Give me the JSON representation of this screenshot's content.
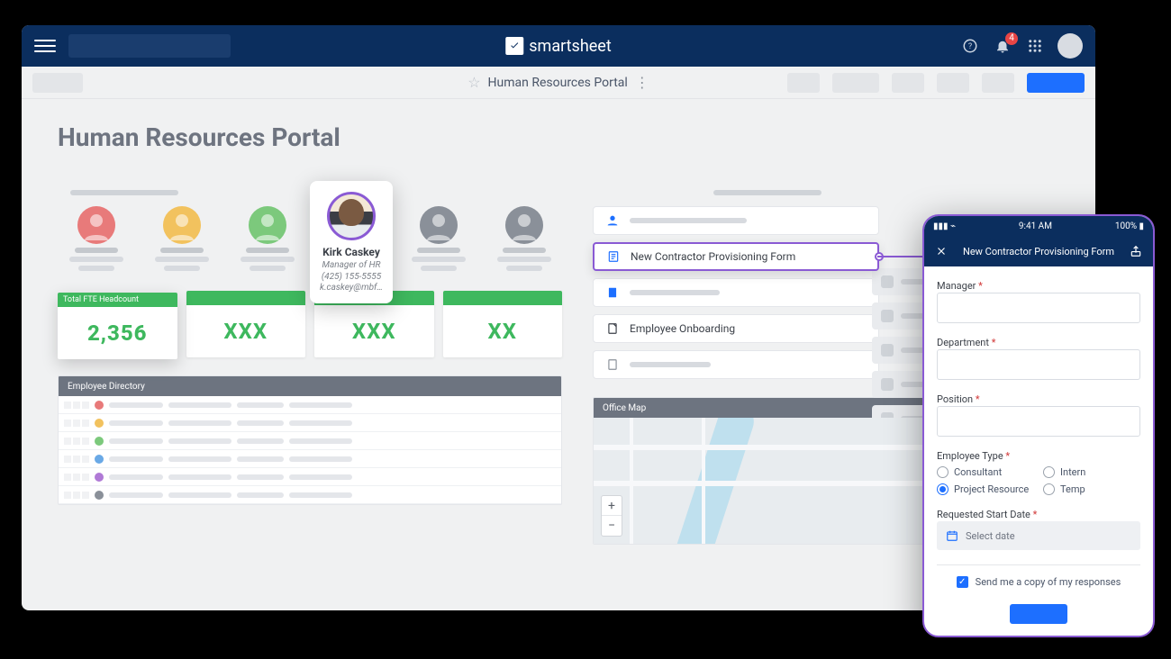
{
  "brand": "smartsheet",
  "topbar": {
    "notif_count": "4"
  },
  "breadcrumb": {
    "title": "Human Resources Portal"
  },
  "page": {
    "title": "Human Resources Portal"
  },
  "person_card": {
    "name": "Kirk Caskey",
    "role": "Manager of HR",
    "phone": "(425) 155-5555",
    "email": "k.caskey@mbf…"
  },
  "kpis": {
    "headcount_label": "Total FTE Headcount",
    "headcount_value": "2,356",
    "v2": "XXX",
    "v3": "XXX",
    "v4": "XX"
  },
  "directory": {
    "title": "Employee Directory"
  },
  "links": {
    "form": "New Contractor Provisioning Form",
    "onboarding": "Employee Onboarding"
  },
  "map": {
    "title": "Office Map"
  },
  "phone": {
    "status_time": "9:41 AM",
    "status_batt": "100%",
    "title": "New Contractor Provisioning Form",
    "manager": "Manager",
    "department": "Department",
    "position": "Position",
    "emp_type": "Employee Type",
    "opt_consultant": "Consultant",
    "opt_intern": "Intern",
    "opt_project": "Project Resource",
    "opt_temp": "Temp",
    "start_date": "Requested Start Date",
    "date_placeholder": "Select date",
    "copy": "Send me a copy of my responses",
    "req": "*"
  },
  "people_colors": [
    "#e87a7a",
    "#f2c25e",
    "#7cc97c",
    "#6aa9e6",
    "#8a9099",
    "#8a9099"
  ],
  "dir_colors": [
    "#e87a7a",
    "#f2c25e",
    "#7cc97c",
    "#6aa9e6",
    "#b07ad6",
    "#8a9099"
  ]
}
